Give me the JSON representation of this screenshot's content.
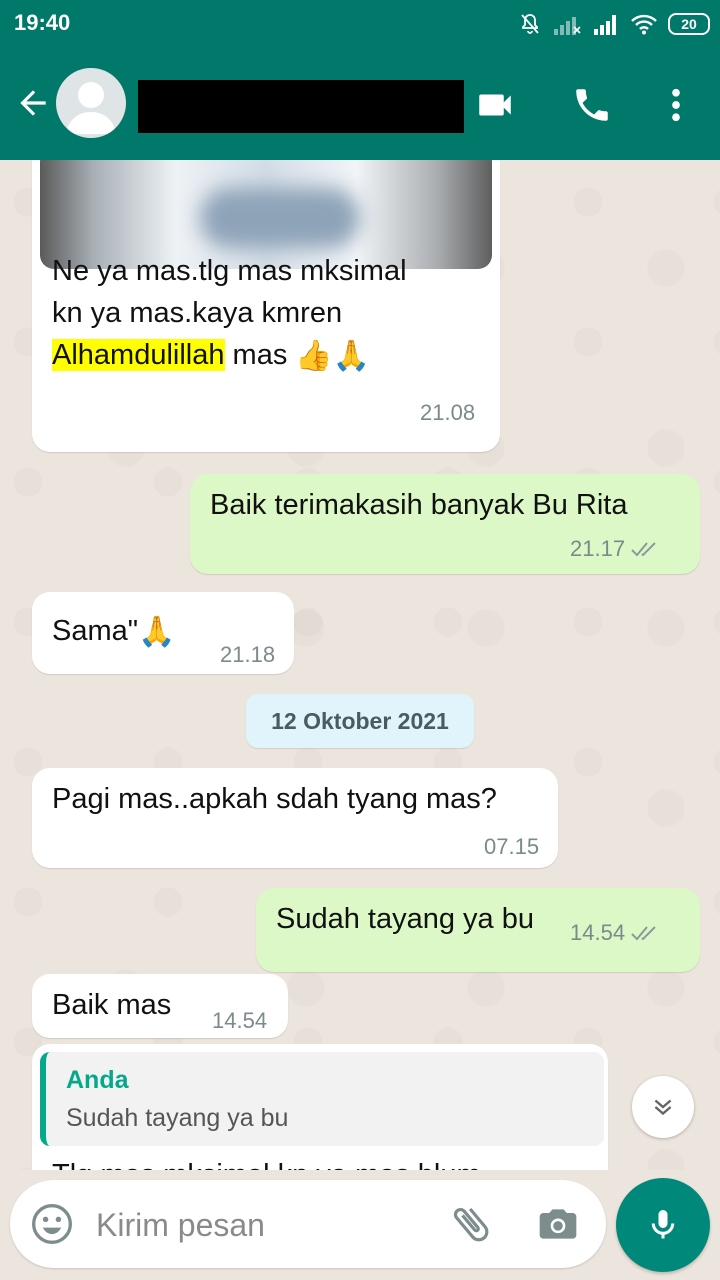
{
  "status_bar": {
    "time": "19:40",
    "battery": "20",
    "icons": [
      "notifications-off-icon",
      "signal-x-icon",
      "signal-icon",
      "wifi-icon",
      "battery-icon"
    ]
  },
  "header": {
    "icons": [
      "back-arrow-icon",
      "avatar-icon",
      "video-call-icon",
      "phone-icon",
      "more-vert-icon"
    ]
  },
  "messages": [
    {
      "direction": "incoming",
      "lines": [
        "Ne ya mas.tlg mas mksimal",
        "kn ya mas.kaya kmren"
      ],
      "highlight": "Alhamdulillah",
      "after_highlight": " mas",
      "emoji": "👍🙏",
      "time": "21.08"
    },
    {
      "direction": "outgoing",
      "text": "Baik terimakasih banyak Bu Rita",
      "time": "21.17"
    },
    {
      "direction": "incoming",
      "text": "Sama\"",
      "emoji": "🙏",
      "time": "21.18"
    },
    {
      "direction": "incoming",
      "text": "Pagi mas..apkah sdah tyang mas?",
      "time": "07.15"
    },
    {
      "direction": "outgoing",
      "text": "Sudah tayang ya bu",
      "time": "14.54"
    },
    {
      "direction": "incoming",
      "text": "Baik mas",
      "time": "14.54"
    },
    {
      "direction": "incoming",
      "quote_author": "Anda",
      "quote_text": "Sudah tayang ya bu",
      "partial_text": "Tlg mas mksimal kn ya mas blum"
    }
  ],
  "date_divider": "12 Oktober 2021",
  "input": {
    "placeholder": "Kirim pesan"
  },
  "colors": {
    "header": "#00796B",
    "outgoing_bubble": "#DCF8C6",
    "incoming_bubble": "#FFFFFF",
    "highlight": "#FFFF00",
    "quote_accent": "#06A88C",
    "mic_button": "#00897B",
    "chat_background": "#ECE5DD"
  }
}
